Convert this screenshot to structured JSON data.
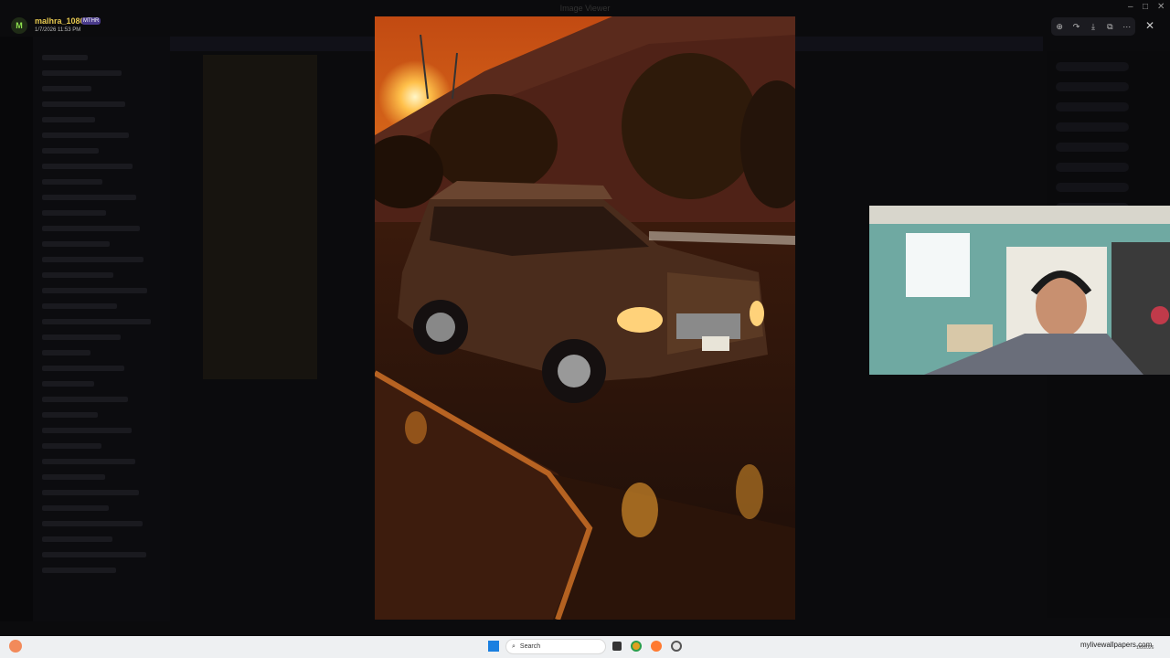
{
  "window": {
    "title": "Image Viewer",
    "controls": [
      "–",
      "□",
      "✕"
    ]
  },
  "viewer": {
    "username": "malhra_1080",
    "badge": "MTHR",
    "avatar_letter": "M",
    "timestamp": "1/7/2026 11:53 PM",
    "toolbar": [
      {
        "icon": "zoom-in-icon",
        "glyph": "⊕"
      },
      {
        "icon": "forward-icon",
        "glyph": "↷"
      },
      {
        "icon": "download-icon",
        "glyph": "⤓"
      },
      {
        "icon": "open-external-icon",
        "glyph": "⧉"
      },
      {
        "icon": "more-icon",
        "glyph": "⋯"
      }
    ],
    "close_glyph": "✕"
  },
  "taskbar": {
    "search_placeholder": "Search",
    "watermark": "mylivewallpapers.com",
    "date": "1/8/2026"
  },
  "colors": {
    "username": "#e6c84f",
    "badge_bg": "#4a3b8c",
    "taskbar_bg": "#eef0f2"
  }
}
